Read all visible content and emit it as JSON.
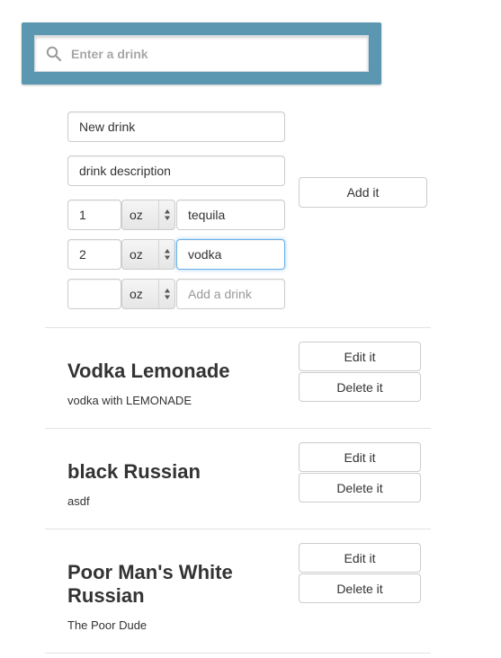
{
  "search": {
    "placeholder": "Enter a drink",
    "value": "",
    "icon": "search-icon",
    "bar_color": "#5b97b1"
  },
  "new_drink_form": {
    "name_value": "New drink",
    "description_value": "drink description",
    "ingredients": [
      {
        "quantity": "1",
        "unit": "oz",
        "name": "tequila",
        "placeholder": "Add a drink"
      },
      {
        "quantity": "2",
        "unit": "oz",
        "name": "vodka",
        "placeholder": "Add a drink"
      },
      {
        "quantity": "",
        "unit": "oz",
        "name": "",
        "placeholder": "Add a drink"
      }
    ],
    "add_label": "Add it"
  },
  "drinks": [
    {
      "name": "Vodka Lemonade",
      "description": "vodka with LEMONADE",
      "edit_label": "Edit it",
      "delete_label": "Delete it"
    },
    {
      "name": "black Russian",
      "description": "asdf",
      "edit_label": "Edit it",
      "delete_label": "Delete it"
    },
    {
      "name": "Poor Man's White Russian",
      "description": "The Poor Dude",
      "edit_label": "Edit it",
      "delete_label": "Delete it"
    }
  ]
}
